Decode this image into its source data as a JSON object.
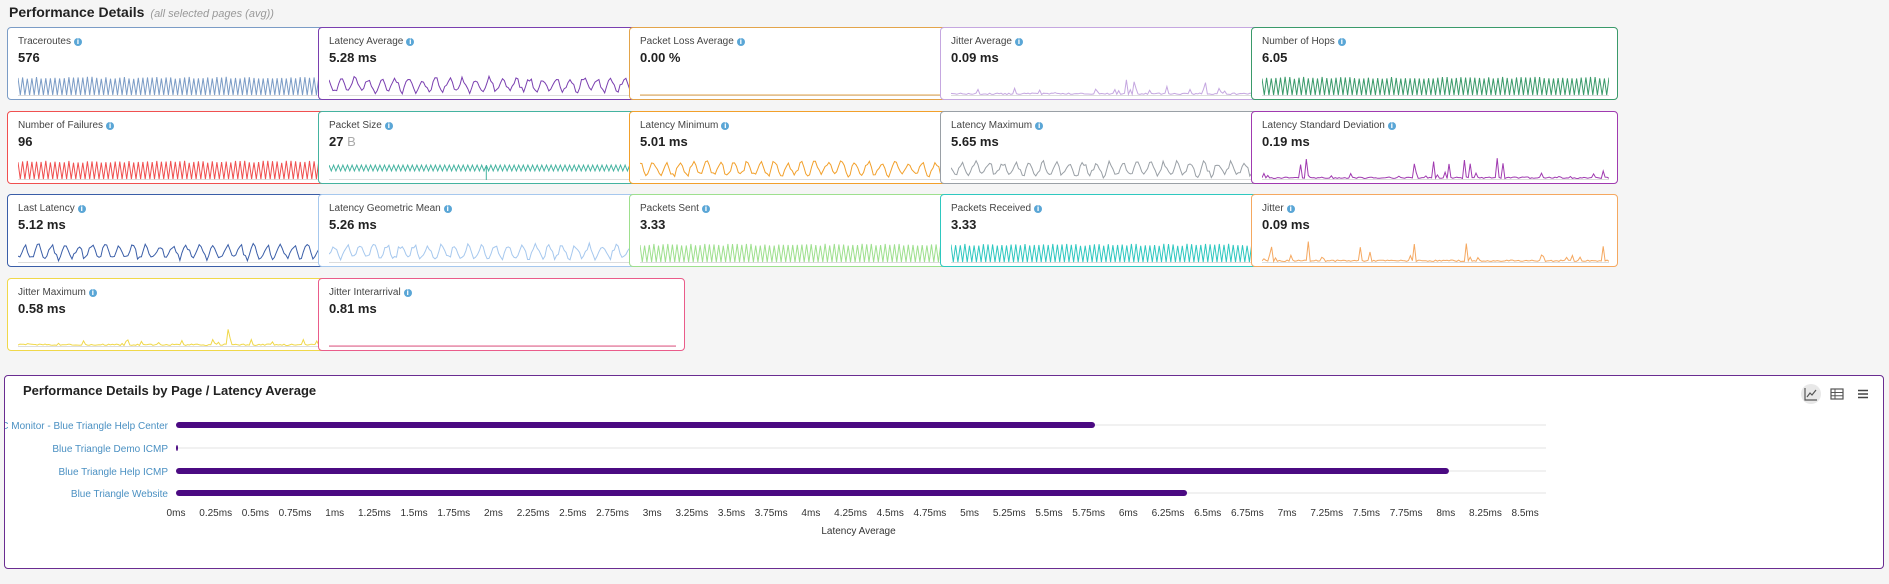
{
  "header": {
    "title": "Performance Details",
    "subtitle": "(all selected pages (avg))"
  },
  "colors": {
    "panel_border": "#6a2c91",
    "bar": "#4b0a82",
    "info": "#5aa6d6"
  },
  "cards": [
    {
      "label": "Traceroutes",
      "value": "576",
      "unit": "",
      "color": "#7b9cc6",
      "pattern": "comb",
      "seed": 1,
      "info_icon": "info-icon"
    },
    {
      "label": "Latency Average",
      "value": "5.28 ms",
      "unit": "",
      "color": "#7a3fb0",
      "pattern": "wave",
      "seed": 2,
      "info_icon": "info-icon"
    },
    {
      "label": "Packet Loss Average",
      "value": "0.00 %",
      "unit": "",
      "color": "#e3a44a",
      "pattern": "flat",
      "seed": 3,
      "info_icon": "info-icon"
    },
    {
      "label": "Jitter Average",
      "value": "0.09 ms",
      "unit": "",
      "color": "#c5a7e0",
      "pattern": "spikes",
      "seed": 4,
      "info_icon": "info-icon"
    },
    {
      "label": "Number of Hops",
      "value": "6.05",
      "unit": "",
      "color": "#3a9a6a",
      "pattern": "comb",
      "seed": 5,
      "info_icon": "info-icon"
    },
    {
      "label": "Number of Failures",
      "value": "96",
      "unit": "",
      "color": "#f05050",
      "pattern": "comb",
      "seed": 6,
      "info_icon": "info-icon"
    },
    {
      "label": "Packet Size",
      "value": "27",
      "unit": "B",
      "color": "#44b3a0",
      "pattern": "combflat",
      "seed": 7,
      "info_icon": "info-icon"
    },
    {
      "label": "Latency Minimum",
      "value": "5.01 ms",
      "unit": "",
      "color": "#f2a02b",
      "pattern": "wave",
      "seed": 8,
      "info_icon": "info-icon"
    },
    {
      "label": "Latency Maximum",
      "value": "5.65 ms",
      "unit": "",
      "color": "#9aa0a6",
      "pattern": "wave",
      "seed": 9,
      "info_icon": "info-icon"
    },
    {
      "label": "Latency Standard Deviation",
      "value": "0.19 ms",
      "unit": "",
      "color": "#a03ab0",
      "pattern": "spikes",
      "seed": 10,
      "info_icon": "info-icon"
    },
    {
      "label": "Last Latency",
      "value": "5.12 ms",
      "unit": "",
      "color": "#3a5ea8",
      "pattern": "wave",
      "seed": 11,
      "info_icon": "info-icon"
    },
    {
      "label": "Latency Geometric Mean",
      "value": "5.26 ms",
      "unit": "",
      "color": "#a6c8ee",
      "pattern": "wave",
      "seed": 12,
      "info_icon": "info-icon"
    },
    {
      "label": "Packets Sent",
      "value": "3.33",
      "unit": "",
      "color": "#9ee08e",
      "pattern": "comb",
      "seed": 13,
      "info_icon": "info-icon"
    },
    {
      "label": "Packets Received",
      "value": "3.33",
      "unit": "",
      "color": "#2ec8c0",
      "pattern": "comb",
      "seed": 14,
      "info_icon": "info-icon"
    },
    {
      "label": "Jitter",
      "value": "0.09 ms",
      "unit": "",
      "color": "#f5a860",
      "pattern": "spikes",
      "seed": 15,
      "info_icon": "info-icon"
    },
    {
      "label": "Jitter Maximum",
      "value": "0.58 ms",
      "unit": "",
      "color": "#f0d84a",
      "pattern": "spikes",
      "seed": 16,
      "info_icon": "info-icon"
    },
    {
      "label": "Jitter Interarrival",
      "value": "0.81 ms",
      "unit": "",
      "color": "#ea5c8a",
      "pattern": "flat",
      "seed": 17,
      "info_icon": "info-icon"
    }
  ],
  "panel": {
    "title": "Performance Details by Page / Latency Average",
    "tools": [
      {
        "icon": "line-chart-icon",
        "active": true
      },
      {
        "icon": "table-icon",
        "active": false
      },
      {
        "icon": "menu-icon",
        "active": false
      }
    ]
  },
  "chart_data": {
    "type": "bar",
    "orientation": "horizontal",
    "categories": [
      "NHC Monitor - Blue Triangle Help Center",
      "Blue Triangle Demo ICMP",
      "Blue Triangle Help ICMP",
      "Blue Triangle Website"
    ],
    "values": [
      5.79,
      0.01,
      8.02,
      6.37
    ],
    "xlabel": "Latency Average",
    "ylabel": "",
    "xlim": [
      0,
      8.6
    ],
    "ticks": [
      "0ms",
      "0.25ms",
      "0.5ms",
      "0.75ms",
      "1ms",
      "1.25ms",
      "1.5ms",
      "1.75ms",
      "2ms",
      "2.25ms",
      "2.5ms",
      "2.75ms",
      "3ms",
      "3.25ms",
      "3.5ms",
      "3.75ms",
      "4ms",
      "4.25ms",
      "4.5ms",
      "4.75ms",
      "5ms",
      "5.25ms",
      "5.5ms",
      "5.75ms",
      "6ms",
      "6.25ms",
      "6.5ms",
      "6.75ms",
      "7ms",
      "7.25ms",
      "7.5ms",
      "7.75ms",
      "8ms",
      "8.25ms",
      "8.5ms"
    ],
    "bar_color": "#4b0a82",
    "grid": true
  }
}
